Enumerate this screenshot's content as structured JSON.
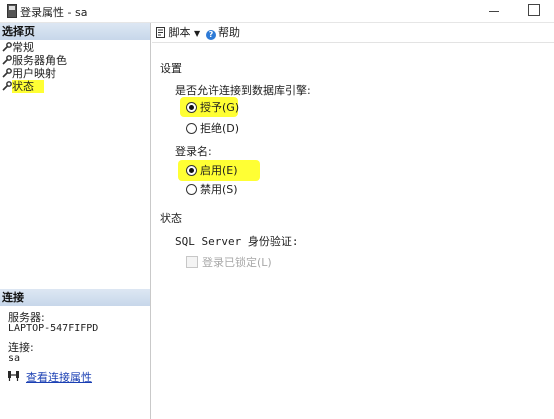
{
  "window": {
    "title": "登录属性 - sa",
    "icon": "document-icon"
  },
  "left_panel": {
    "pages_header": "选择页",
    "pages": [
      {
        "label": "常规",
        "selected": false
      },
      {
        "label": "服务器角色",
        "selected": false
      },
      {
        "label": "用户映射",
        "selected": false
      },
      {
        "label": "状态",
        "selected": true
      }
    ],
    "connection_header": "连接",
    "server_label": "服务器:",
    "server_value": "LAPTOP-547FIFPD",
    "connection_label": "连接:",
    "connection_value": "sa",
    "view_connection_link": "查看连接属性"
  },
  "toolbar": {
    "script_label": "脚本",
    "help_label": "帮助"
  },
  "settings": {
    "section_title": "设置",
    "permission_question": "是否允许连接到数据库引擎:",
    "grant_label": "授予(G)",
    "deny_label": "拒绝(D)",
    "permission_selected": "授予(G)",
    "login_label": "登录名:",
    "enabled_label": "启用(E)",
    "disabled_label": "禁用(S)",
    "login_selected": "启用(E)"
  },
  "status": {
    "section_title": "状态",
    "auth_label": "SQL Server 身份验证:",
    "locked_label": "登录已锁定(L)",
    "locked_checked": false,
    "locked_enabled": false
  },
  "colors": {
    "highlight": "#ffff34",
    "panel_header": "#c7d7ea",
    "link": "#1a3fb3",
    "help_icon": "#2d7ad6"
  }
}
